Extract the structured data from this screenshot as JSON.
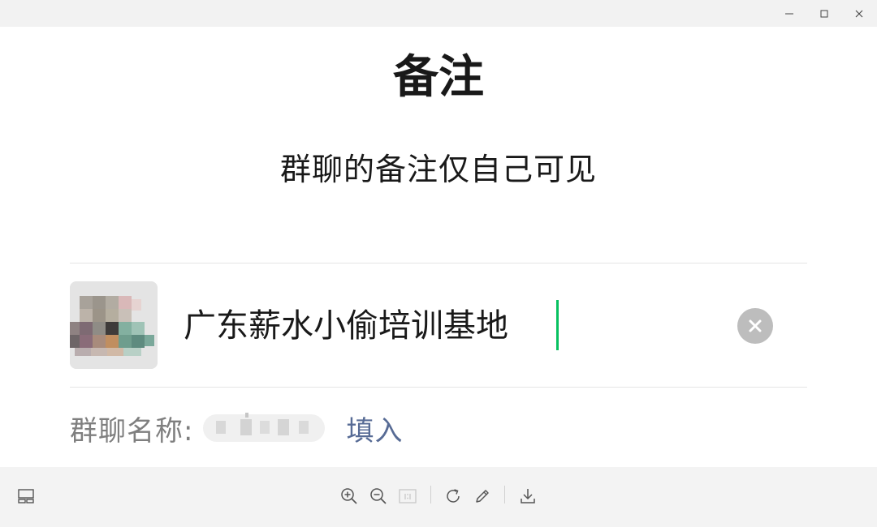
{
  "window": {
    "controls": [
      "minimize-icon",
      "maximize-icon",
      "close-icon"
    ]
  },
  "dialog": {
    "title": "备注",
    "subtitle": "群聊的备注仅自己可见",
    "remark_input": {
      "value": "广东薪水小偷培训基地",
      "placeholder": ""
    },
    "clear_icon": "clear-circle-icon",
    "group_name_label": "群聊名称:",
    "fill_link": "填入"
  },
  "toolbar": {
    "left": [
      "layout-icon"
    ],
    "center": [
      "zoom-in-icon",
      "zoom-out-icon",
      "actual-size-icon",
      "rotate-icon",
      "edit-icon",
      "download-icon"
    ]
  },
  "colors": {
    "accent": "#07c160",
    "link": "#576b95",
    "clear_button": "#bdbdbd"
  }
}
